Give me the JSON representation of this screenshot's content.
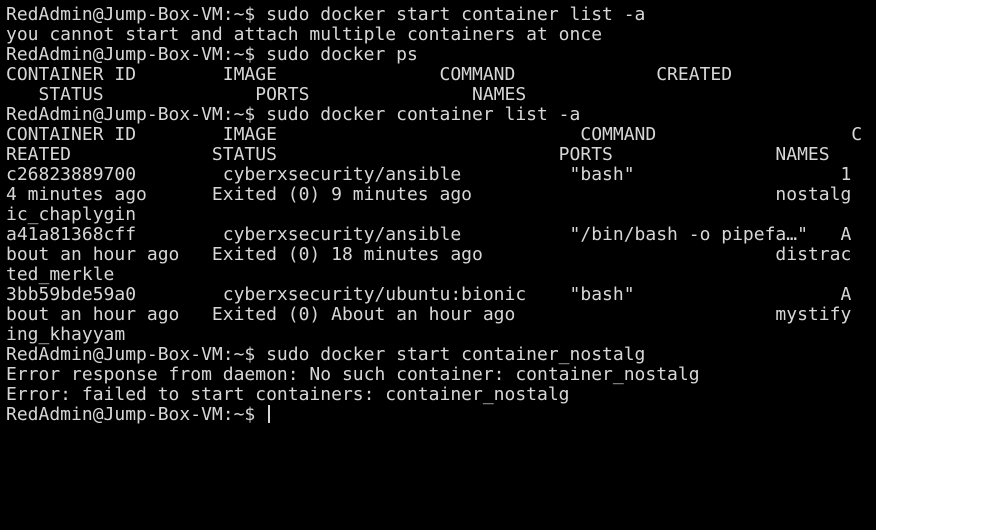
{
  "terminal": {
    "lines": [
      "RedAdmin@Jump-Box-VM:~$ sudo docker start container list -a",
      "you cannot start and attach multiple containers at once",
      "RedAdmin@Jump-Box-VM:~$ sudo docker ps",
      "CONTAINER ID        IMAGE               COMMAND             CREATED",
      "   STATUS              PORTS               NAMES",
      "RedAdmin@Jump-Box-VM:~$ sudo docker container list -a",
      "CONTAINER ID        IMAGE                            COMMAND                  C",
      "REATED             STATUS                          PORTS               NAMES",
      "c26823889700        cyberxsecurity/ansible          \"bash\"                   1",
      "4 minutes ago      Exited (0) 9 minutes ago                            nostalg",
      "ic_chaplygin",
      "a41a81368cff        cyberxsecurity/ansible          \"/bin/bash -o pipefa…\"   A",
      "bout an hour ago   Exited (0) 18 minutes ago                           distrac",
      "ted_merkle",
      "3bb59bde59a0        cyberxsecurity/ubuntu:bionic    \"bash\"                   A",
      "bout an hour ago   Exited (0) About an hour ago                        mystify",
      "ing_khayyam",
      "RedAdmin@Jump-Box-VM:~$ sudo docker start container_nostalg",
      "Error response from daemon: No such container: container_nostalg",
      "Error: failed to start containers: container_nostalg"
    ],
    "prompt": "RedAdmin@Jump-Box-VM:~$ "
  }
}
